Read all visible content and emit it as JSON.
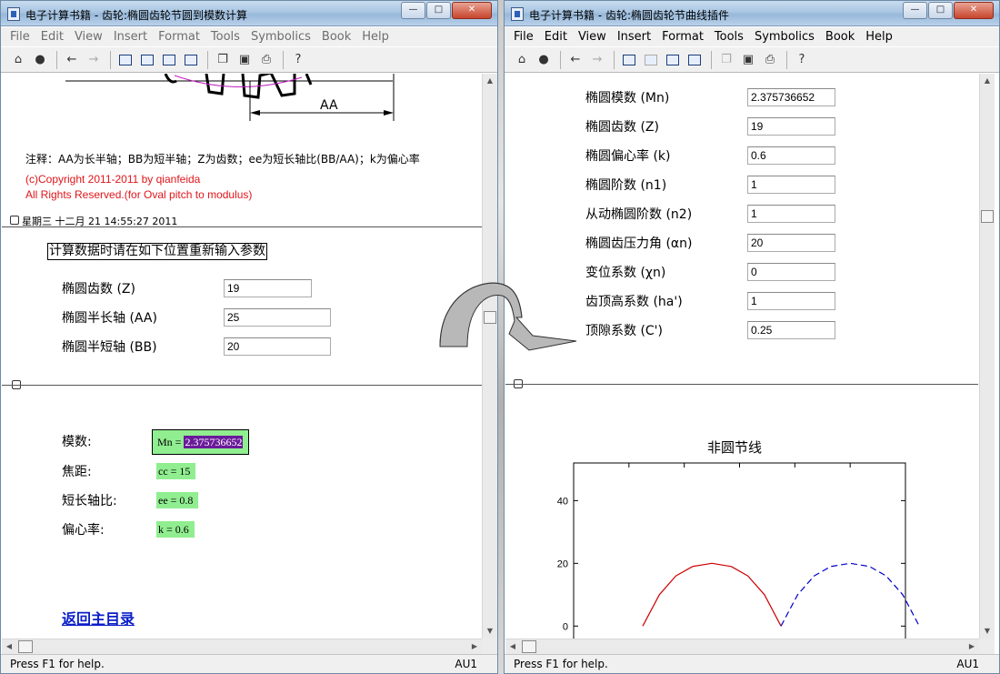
{
  "left": {
    "title": "电子计算书籍 - 齿轮:椭圆齿轮节圆到模数计算",
    "menu": [
      "File",
      "Edit",
      "View",
      "Insert",
      "Format",
      "Tools",
      "Symbolics",
      "Book",
      "Help"
    ],
    "drawing_label": "AA",
    "note": "注释：AA为长半轴；BB为短半轴；Z为齿数；ee为短长轴比(BB/AA)；k为偏心率",
    "copyright": "(c)Copyright 2011-2011 by qianfeida",
    "rights": "All Rights Reserved.(for Oval pitch to modulus)",
    "datestamp": "星期三 十二月 21 14:55:27 2011",
    "reinput_label": "计算数据时请在如下位置重新输入参数",
    "inputs": [
      {
        "label": "椭圆齿数 (Z)",
        "value": "19"
      },
      {
        "label": "椭圆半长轴 (AA)",
        "value": "25"
      },
      {
        "label": "椭圆半短轴 (BB)",
        "value": "20"
      }
    ],
    "results": [
      {
        "label": "模数:",
        "prefix": "Mn = ",
        "value": "2.375736652"
      },
      {
        "label": "焦距:",
        "text": "cc = 15"
      },
      {
        "label": "短长轴比:",
        "text": "ee = 0.8"
      },
      {
        "label": "偏心率:",
        "text": "k = 0.6"
      }
    ],
    "back_link": "返回主目录",
    "status": "Press F1 for help.",
    "status_right": "AU1"
  },
  "right": {
    "title": "电子计算书籍 - 齿轮:椭圆齿轮节曲线插件",
    "menu": [
      "File",
      "Edit",
      "View",
      "Insert",
      "Format",
      "Tools",
      "Symbolics",
      "Book",
      "Help"
    ],
    "params": [
      {
        "label": "椭圆模数 (Mn)",
        "value": "2.375736652"
      },
      {
        "label": "椭圆齿数 (Z)",
        "value": "19"
      },
      {
        "label": "椭圆偏心率 (k)",
        "value": "0.6"
      },
      {
        "label": "椭圆阶数 (n1)",
        "value": "1"
      },
      {
        "label": "从动椭圆阶数 (n2)",
        "value": "1"
      },
      {
        "label": "椭圆齿压力角 (αn)",
        "value": "20"
      },
      {
        "label": "变位系数 (χn)",
        "value": "0"
      },
      {
        "label": "齿顶高系数 (ha')",
        "value": "1"
      },
      {
        "label": "顶隙系数 (C')",
        "value": "0.25"
      }
    ],
    "status": "Press F1 for help.",
    "status_right": "AU1"
  },
  "chart_data": {
    "type": "line",
    "title": "非圆节线",
    "xlabel": "",
    "ylabel": "",
    "yticks": [
      40,
      20,
      0
    ],
    "ylim": [
      -6,
      52
    ],
    "xlim": [
      -25,
      95
    ],
    "series": [
      {
        "color": "#cc0000",
        "style": "solid",
        "x": [
          0,
          6,
          12,
          18,
          25,
          32,
          38,
          44,
          50
        ],
        "y": [
          0,
          10,
          16,
          19,
          20,
          19,
          16,
          10,
          0
        ]
      },
      {
        "color": "#0000cc",
        "style": "dashed",
        "x": [
          50,
          56,
          62,
          68,
          75,
          82,
          88,
          94,
          100
        ],
        "y": [
          0,
          10,
          16,
          19,
          20,
          19,
          16,
          10,
          0
        ]
      }
    ]
  },
  "colors": {
    "result_bg": "#90ee90",
    "selection": "#6a1b9a",
    "copyright": "#e1151a",
    "link": "#0a1ec8"
  }
}
